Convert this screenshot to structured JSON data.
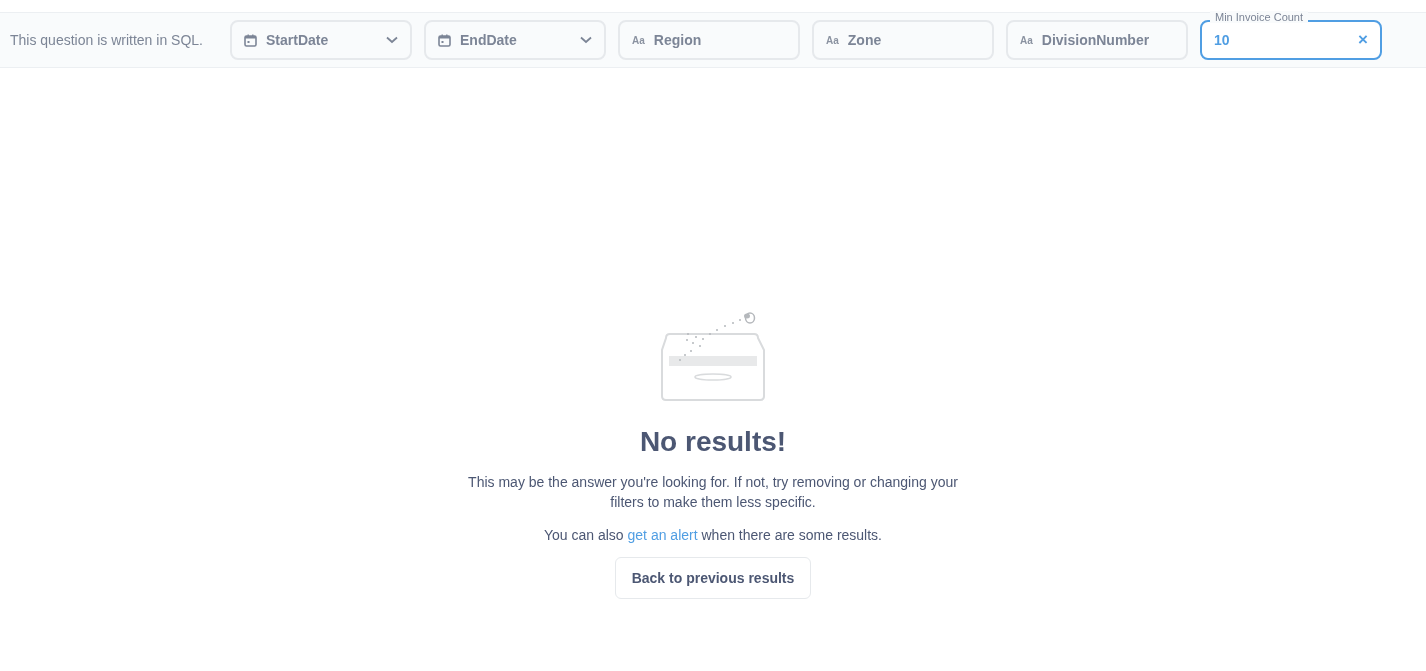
{
  "toolbar": {
    "note": "This question is written in SQL.",
    "filters": [
      {
        "kind": "date",
        "label": "StartDate"
      },
      {
        "kind": "date",
        "label": "EndDate"
      },
      {
        "kind": "text",
        "prefix": "Aa",
        "label": "Region"
      },
      {
        "kind": "text",
        "prefix": "Aa",
        "label": "Zone"
      },
      {
        "kind": "text",
        "prefix": "Aa",
        "label": "DivisionNumber"
      },
      {
        "kind": "filled",
        "label": "Min Invoice Count",
        "value": "10",
        "clear": "×"
      }
    ]
  },
  "empty_state": {
    "title": "No results!",
    "message": "This may be the answer you're looking for. If not, try removing or changing your filters to make them less specific.",
    "hint": {
      "before": "You can also ",
      "link": "get an alert",
      "after": " when there are some results."
    },
    "button": "Back to previous results"
  }
}
